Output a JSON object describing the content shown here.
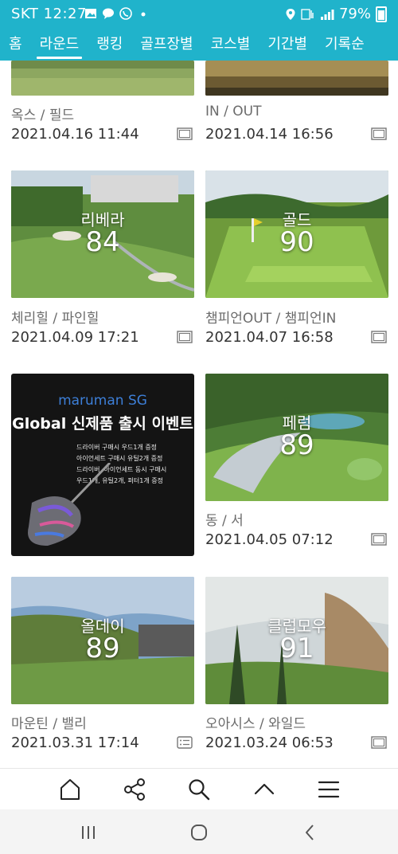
{
  "status_bar": {
    "carrier": "SKT",
    "time": "12:27",
    "battery": "79%"
  },
  "nav": {
    "tabs": [
      "홈",
      "라운드",
      "랭킹",
      "골프장별",
      "코스별",
      "기간별",
      "기록순"
    ],
    "active_index": 1
  },
  "rounds": [
    {
      "course": "옥스 / 필드",
      "date": "2021.04.16 11:44",
      "icon": "photo-frame-icon"
    },
    {
      "course": "IN / OUT",
      "date": "2021.04.14 16:56",
      "icon": "photo-frame-icon"
    },
    {
      "club": "리베라",
      "score": "84",
      "course": "체리힐 / 파인힐",
      "date": "2021.04.09 17:21",
      "icon": "photo-frame-icon"
    },
    {
      "club": "골드",
      "score": "90",
      "course": "챔피언OUT / 챔피언IN",
      "date": "2021.04.07 16:58",
      "icon": "photo-frame-icon"
    },
    {
      "club": "페럼",
      "score": "89",
      "course": "동 / 서",
      "date": "2021.04.05 07:12",
      "icon": "photo-frame-icon"
    },
    {
      "club": "올데이",
      "score": "89",
      "course": "마운틴 / 밸리",
      "date": "2021.03.31 17:14",
      "icon": "scorecard-icon"
    },
    {
      "club": "클럽모우",
      "score": "91",
      "course": "오아시스 / 와일드",
      "date": "2021.03.24 06:53",
      "icon": "photo-frame-icon"
    }
  ],
  "ad": {
    "brand": "maruman SG",
    "title": "Global 신제품 출시 이벤트",
    "lines": [
      "드라이버 구매시 우드1개 증정",
      "아이언세트 구매시 유틸2개 증정",
      "드라이버, 아이언세트 동시 구매시",
      "우드1개, 유틸2개, 퍼터1개 증정"
    ]
  },
  "toolbar": {
    "buttons": [
      "home-icon",
      "share-icon",
      "search-icon",
      "chevron-up-icon",
      "menu-icon"
    ]
  },
  "system_nav": {
    "buttons": [
      "recent-apps-icon",
      "home-circle-icon",
      "back-icon"
    ]
  },
  "colors": {
    "accent": "#20b3cb"
  }
}
